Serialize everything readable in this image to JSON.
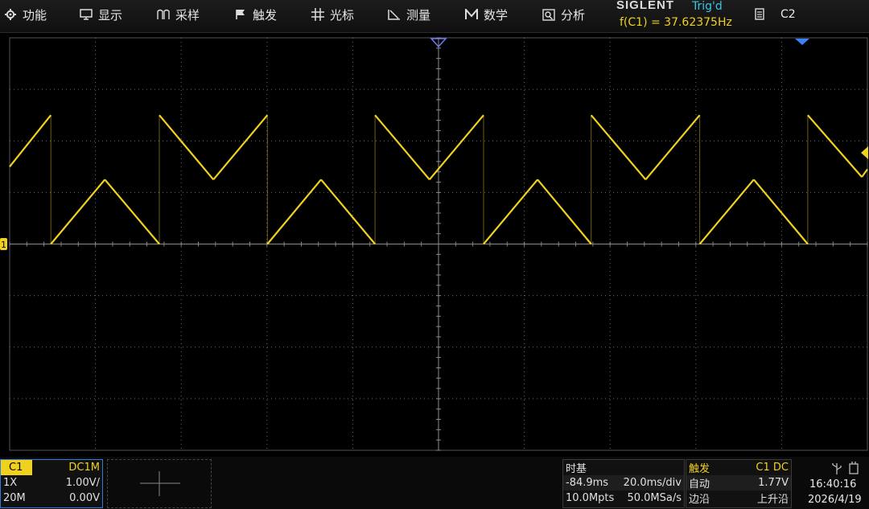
{
  "menu": [
    {
      "label": "功能",
      "icon": "gear-icon"
    },
    {
      "label": "显示",
      "icon": "monitor-icon"
    },
    {
      "label": "采样",
      "icon": "sampling-icon"
    },
    {
      "label": "触发",
      "icon": "flag-icon"
    },
    {
      "label": "光标",
      "icon": "cursor-icon"
    },
    {
      "label": "测量",
      "icon": "measure-icon"
    },
    {
      "label": "数学",
      "icon": "math-icon"
    },
    {
      "label": "分析",
      "icon": "analysis-icon"
    }
  ],
  "header": {
    "brand": "SIGLENT",
    "trigger_status": "Trig'd",
    "frequency_readout": "f(C1) = 37.62375Hz",
    "channel_button": "C2"
  },
  "channel1": {
    "name": "C1",
    "coupling": "DC1M",
    "probe": "1X",
    "scale": "1.00V/",
    "bandwidth": "20M",
    "offset": "0.00V",
    "marker": "1"
  },
  "timebase": {
    "title": "时基",
    "delay": "-84.9ms",
    "scale": "20.0ms/div",
    "memory": "10.0Mpts",
    "sample_rate": "50.0MSa/s"
  },
  "trigger": {
    "title": "触发",
    "source": "C1 DC",
    "mode": "自动",
    "level": "1.77V",
    "type": "边沿",
    "slope": "上升沿"
  },
  "clock": {
    "time": "16:40:16",
    "date": "2026/4/19"
  },
  "colors": {
    "trace": "#f0d21e",
    "grid": "#6a6a6a",
    "accent": "#39c6e8",
    "trigger_marker": "#3b82f6"
  },
  "chart_data": {
    "type": "line",
    "xlabel": "",
    "ylabel": "",
    "x_divisions": 10,
    "y_divisions": 8,
    "xlim": [
      -184.9,
      15.1
    ],
    "ylim": [
      -4,
      4
    ],
    "series": [
      {
        "x": [
          -184.9,
          -175.3,
          -175.3,
          -162.7,
          -150.0,
          -150.0,
          -137.4,
          -124.8,
          -124.8,
          -112.3,
          -99.7,
          -99.7,
          -87.0,
          -74.4,
          -74.4,
          -61.8,
          -49.3,
          -49.3,
          -36.6,
          -24.0,
          -24.0,
          -11.4,
          1.2,
          1.2,
          13.8,
          15.1
        ],
        "y": [
          1.5,
          2.5,
          0,
          1.25,
          0,
          2.5,
          1.25,
          2.5,
          0,
          1.25,
          0,
          2.5,
          1.25,
          2.5,
          0,
          1.25,
          0,
          2.5,
          1.25,
          2.5,
          0,
          1.25,
          0,
          2.5,
          1.3,
          1.45
        ]
      }
    ]
  }
}
